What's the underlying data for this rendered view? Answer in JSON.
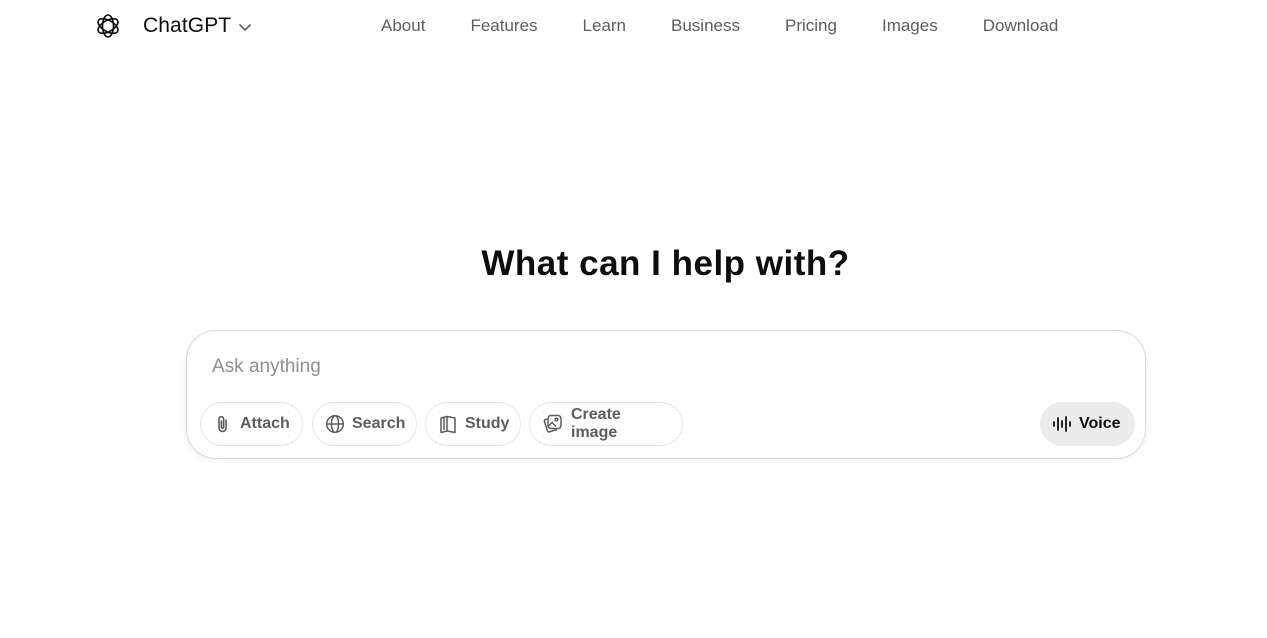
{
  "header": {
    "brand_name": "ChatGPT",
    "nav": [
      "About",
      "Features",
      "Learn",
      "Business",
      "Pricing",
      "Images",
      "Download"
    ]
  },
  "main": {
    "headline": "What can I help with?",
    "composer": {
      "placeholder": "Ask anything",
      "tools": {
        "attach": "Attach",
        "search": "Search",
        "study": "Study",
        "create_image": "Create image"
      },
      "voice": "Voice"
    }
  },
  "icons": {
    "logo": "openai-logo-icon",
    "chevron": "chevron-down-icon",
    "attach": "paperclip-icon",
    "search": "globe-icon",
    "study": "book-icon",
    "create_image": "image-icon",
    "voice": "waveform-icon"
  },
  "colors": {
    "text": "#0d0d0d",
    "muted": "#5d5d5d",
    "placeholder": "#8f8f8f",
    "voice_bg": "#ececec",
    "border": "#d9d9d9"
  }
}
